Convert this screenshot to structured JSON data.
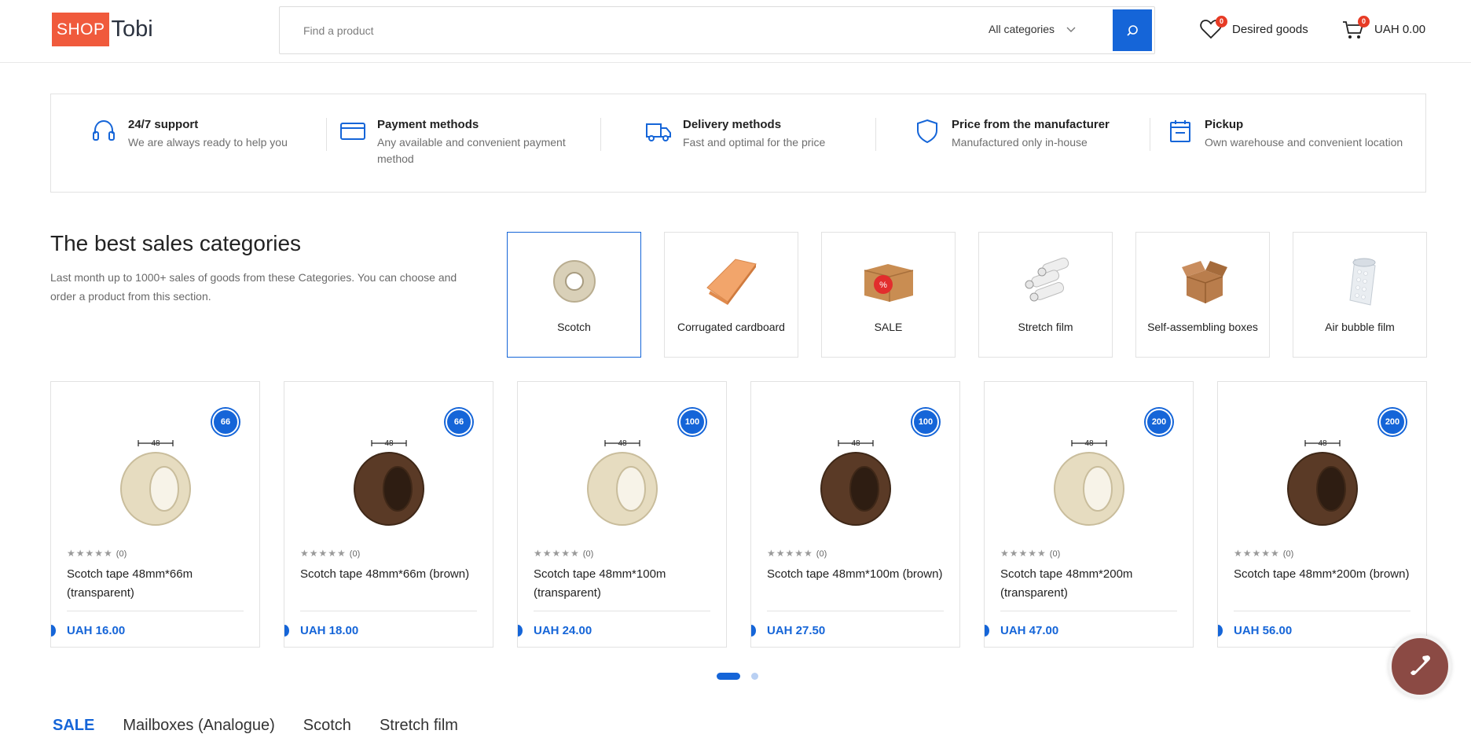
{
  "header": {
    "logo_shop": "SHOP",
    "logo_tobi": "Tobi",
    "search_placeholder": "Find a product",
    "category_select": "All categories",
    "wishlist_label": "Desired goods",
    "wishlist_count": "0",
    "cart_label": "UAH 0.00",
    "cart_count": "0"
  },
  "features": [
    {
      "title": "24/7 support",
      "subtitle": "We are always ready to help you",
      "icon": "headset-icon"
    },
    {
      "title": "Payment methods",
      "subtitle": "Any available and convenient payment method",
      "icon": "credit-card-icon"
    },
    {
      "title": "Delivery methods",
      "subtitle": "Fast and optimal for the price",
      "icon": "truck-icon"
    },
    {
      "title": "Price from the manufacturer",
      "subtitle": "Manufactured only in-house",
      "icon": "shield-icon"
    },
    {
      "title": "Pickup",
      "subtitle": "Own warehouse and convenient location",
      "icon": "calendar-icon"
    }
  ],
  "categories": {
    "title": "The best sales categories",
    "description": "Last month up to 1000+ sales of goods from these Categories. You can choose and order a product from this section.",
    "items": [
      {
        "label": "Scotch",
        "icon": "tape-roll-icon"
      },
      {
        "label": "Corrugated cardboard",
        "icon": "cardboard-sheets-icon"
      },
      {
        "label": "SALE",
        "icon": "sale-box-icon"
      },
      {
        "label": "Stretch film",
        "icon": "stretch-film-icon"
      },
      {
        "label": "Self-assembling boxes",
        "icon": "open-box-icon"
      },
      {
        "label": "Air bubble film",
        "icon": "bubble-film-icon"
      }
    ]
  },
  "products": [
    {
      "badge": "66",
      "rating_count": "(0)",
      "name": "Scotch tape 48mm*66m (transparent)",
      "price": "UAH 16.00",
      "tape": "transparent"
    },
    {
      "badge": "66",
      "rating_count": "(0)",
      "name": "Scotch tape 48mm*66m (brown)",
      "price": "UAH 18.00",
      "tape": "brown"
    },
    {
      "badge": "100",
      "rating_count": "(0)",
      "name": "Scotch tape 48mm*100m (transparent)",
      "price": "UAH 24.00",
      "tape": "transparent"
    },
    {
      "badge": "100",
      "rating_count": "(0)",
      "name": "Scotch tape 48mm*100m (brown)",
      "price": "UAH 27.50",
      "tape": "brown"
    },
    {
      "badge": "200",
      "rating_count": "(0)",
      "name": "Scotch tape 48mm*200m (transparent)",
      "price": "UAH 47.00",
      "tape": "transparent"
    },
    {
      "badge": "200",
      "rating_count": "(0)",
      "name": "Scotch tape 48mm*200m (brown)",
      "price": "UAH 56.00",
      "tape": "brown"
    }
  ],
  "product_image_label": "48",
  "stars": "★★★★★",
  "tabs": [
    {
      "label": "SALE",
      "active": true
    },
    {
      "label": "Mailboxes (Analogue)",
      "active": false
    },
    {
      "label": "Scotch",
      "active": false
    },
    {
      "label": "Stretch film",
      "active": false
    }
  ],
  "colors": {
    "accent": "#1565d8",
    "brand": "#f05a3c",
    "badge": "#e73b25",
    "call_button": "#8b4a44"
  }
}
